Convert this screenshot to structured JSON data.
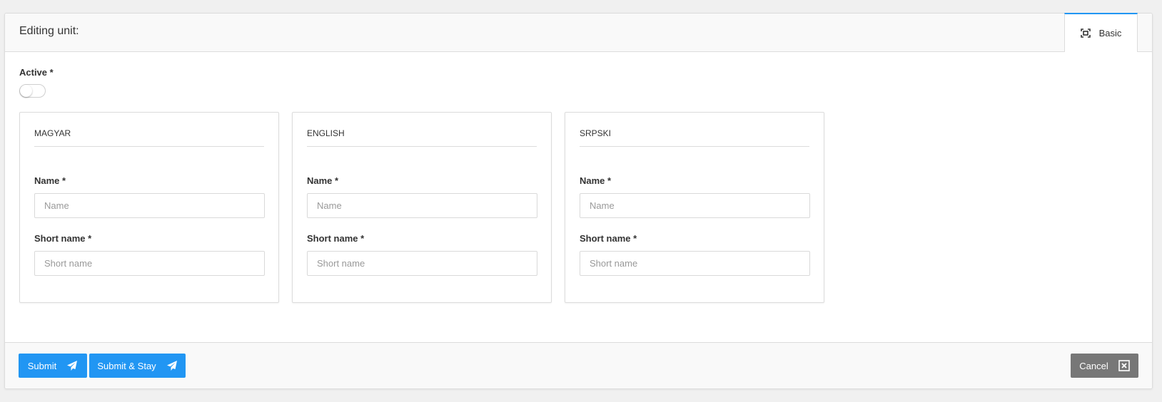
{
  "header": {
    "title": "Editing unit:"
  },
  "tabs": [
    {
      "label": "Basic",
      "icon": "fullscreen-icon",
      "active": true
    }
  ],
  "active_field": {
    "label": "Active *",
    "value": false
  },
  "languages": [
    {
      "title": "MAGYAR",
      "name_label": "Name *",
      "name_placeholder": "Name",
      "name_value": "",
      "short_label": "Short name *",
      "short_placeholder": "Short name",
      "short_value": ""
    },
    {
      "title": "ENGLISH",
      "name_label": "Name *",
      "name_placeholder": "Name",
      "name_value": "",
      "short_label": "Short name *",
      "short_placeholder": "Short name",
      "short_value": ""
    },
    {
      "title": "SRPSKI",
      "name_label": "Name *",
      "name_placeholder": "Name",
      "name_value": "",
      "short_label": "Short name *",
      "short_placeholder": "Short name",
      "short_value": ""
    }
  ],
  "footer": {
    "submit_label": "Submit",
    "submit_stay_label": "Submit & Stay",
    "cancel_label": "Cancel"
  },
  "colors": {
    "primary": "#2196f3",
    "cancel": "#777777"
  }
}
